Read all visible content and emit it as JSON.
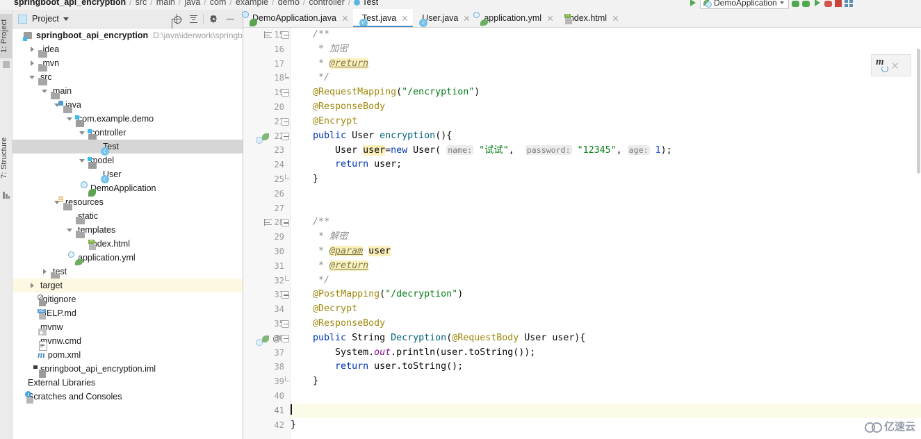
{
  "window": {
    "breadcrumb": [
      "springboot_api_encryption",
      "src",
      "main",
      "java",
      "com",
      "example",
      "demo",
      "controller",
      "Test"
    ],
    "run_config_label": "DemoApplication"
  },
  "left_tool_tabs": [
    {
      "label": "1: Project",
      "selected": true,
      "icon": "project-icon"
    },
    {
      "label": "7: Structure",
      "selected": false,
      "icon": "structure-icon"
    }
  ],
  "project_panel": {
    "title": "Project",
    "toolbar": [
      {
        "name": "locate-in-tree-icon",
        "tooltip": "Select Opened File"
      },
      {
        "name": "collapse-all-icon",
        "tooltip": "Collapse All"
      },
      {
        "name": "gear-icon",
        "tooltip": "Settings"
      },
      {
        "name": "minimize-icon",
        "tooltip": "Hide"
      }
    ],
    "root": {
      "label": "springboot_api_encryption",
      "path": "D:\\java\\iderwork\\springbo"
    },
    "items": [
      {
        "label": ".idea",
        "indent": 1,
        "icon": "folder-icon",
        "arrow": "right",
        "state": "normal"
      },
      {
        "label": ".mvn",
        "indent": 1,
        "icon": "folder-icon",
        "arrow": "right",
        "state": "normal"
      },
      {
        "label": "src",
        "indent": 1,
        "icon": "folder-icon",
        "arrow": "down",
        "state": "normal"
      },
      {
        "label": "main",
        "indent": 2,
        "icon": "folder-icon",
        "arrow": "down",
        "state": "normal"
      },
      {
        "label": "java",
        "indent": 3,
        "icon": "source-folder-icon",
        "arrow": "down",
        "state": "normal"
      },
      {
        "label": "com.example.demo",
        "indent": 4,
        "icon": "package-icon",
        "arrow": "down",
        "state": "normal"
      },
      {
        "label": "controller",
        "indent": 5,
        "icon": "package-icon",
        "arrow": "down",
        "state": "normal"
      },
      {
        "label": "Test",
        "indent": 6,
        "icon": "java-class-icon",
        "arrow": "none",
        "state": "selected"
      },
      {
        "label": "model",
        "indent": 5,
        "icon": "package-icon",
        "arrow": "down",
        "state": "normal"
      },
      {
        "label": "User",
        "indent": 6,
        "icon": "java-class-icon",
        "arrow": "none",
        "state": "normal"
      },
      {
        "label": "DemoApplication",
        "indent": 5,
        "icon": "spring-class-icon",
        "arrow": "none",
        "state": "normal"
      },
      {
        "label": "resources",
        "indent": 3,
        "icon": "resource-folder-icon",
        "arrow": "down",
        "state": "normal"
      },
      {
        "label": "static",
        "indent": 4,
        "icon": "folder-icon",
        "arrow": "none",
        "state": "normal"
      },
      {
        "label": "templates",
        "indent": 4,
        "icon": "folder-icon",
        "arrow": "down",
        "state": "normal"
      },
      {
        "label": "index.html",
        "indent": 5,
        "icon": "html-file-icon",
        "arrow": "none",
        "state": "normal"
      },
      {
        "label": "application.yml",
        "indent": 4,
        "icon": "yml-spring-icon",
        "arrow": "none",
        "state": "normal"
      },
      {
        "label": "test",
        "indent": 2,
        "icon": "folder-icon",
        "arrow": "right",
        "state": "normal"
      },
      {
        "label": "target",
        "indent": 1,
        "icon": "folder-orange-icon",
        "arrow": "right",
        "state": "highlight"
      },
      {
        "label": ".gitignore",
        "indent": 1,
        "icon": "gitignore-icon",
        "arrow": "none",
        "state": "normal"
      },
      {
        "label": "HELP.md",
        "indent": 1,
        "icon": "markdown-icon",
        "arrow": "none",
        "state": "normal"
      },
      {
        "label": "mvnw",
        "indent": 1,
        "icon": "shell-script-icon",
        "arrow": "none",
        "state": "normal"
      },
      {
        "label": "mvnw.cmd",
        "indent": 1,
        "icon": "text-file-icon",
        "arrow": "none",
        "state": "normal"
      },
      {
        "label": "pom.xml",
        "indent": 1,
        "icon": "maven-xml-icon",
        "arrow": "none",
        "state": "normal"
      },
      {
        "label": "springboot_api_encryption.iml",
        "indent": 1,
        "icon": "iml-module-icon",
        "arrow": "none",
        "state": "normal"
      },
      {
        "label": "External Libraries",
        "indent": 0,
        "icon": "external-libraries-icon",
        "arrow": "none",
        "state": "normal"
      },
      {
        "label": "Scratches and Consoles",
        "indent": 0,
        "icon": "scratches-icon",
        "arrow": "none",
        "state": "normal"
      }
    ]
  },
  "editor_tabs": [
    {
      "label": "DemoApplication.java",
      "icon": "spring-class-icon",
      "active": false
    },
    {
      "label": "Test.java",
      "icon": "java-class-icon",
      "active": true
    },
    {
      "label": "User.java",
      "icon": "java-class-icon",
      "active": false
    },
    {
      "label": "application.yml",
      "icon": "yml-spring-icon",
      "active": false
    },
    {
      "label": "index.html",
      "icon": "html-file-icon",
      "active": false
    }
  ],
  "code": {
    "first_line": 15,
    "lines": [
      {
        "n": 15,
        "fold": "open",
        "bookmark": true,
        "tokens": [
          {
            "t": "    ",
            "c": "pln"
          },
          {
            "t": "/**",
            "c": "cmt"
          }
        ]
      },
      {
        "n": 16,
        "tokens": [
          {
            "t": "     * ",
            "c": "cmt"
          },
          {
            "t": "加密",
            "c": "cmt"
          }
        ]
      },
      {
        "n": 17,
        "tokens": [
          {
            "t": "     * ",
            "c": "cmt"
          },
          {
            "t": "@return",
            "c": "tag hlv"
          }
        ]
      },
      {
        "n": 18,
        "fold": "tail",
        "tokens": [
          {
            "t": "     */",
            "c": "cmt"
          }
        ]
      },
      {
        "n": 19,
        "fold": "open",
        "tokens": [
          {
            "t": "    ",
            "c": "pln"
          },
          {
            "t": "@RequestMapping",
            "c": "anno"
          },
          {
            "t": "(",
            "c": "pln"
          },
          {
            "t": "\"/encryption\"",
            "c": "str"
          },
          {
            "t": ")",
            "c": "pln"
          }
        ]
      },
      {
        "n": 20,
        "tokens": [
          {
            "t": "    ",
            "c": "pln"
          },
          {
            "t": "@ResponseBody",
            "c": "anno"
          }
        ]
      },
      {
        "n": 21,
        "fold": "open",
        "tokens": [
          {
            "t": "    ",
            "c": "pln"
          },
          {
            "t": "@Encrypt",
            "c": "anno"
          }
        ]
      },
      {
        "n": 22,
        "fold": "open",
        "spring": true,
        "tokens": [
          {
            "t": "    ",
            "c": "pln"
          },
          {
            "t": "public",
            "c": "kw"
          },
          {
            "t": " User ",
            "c": "pln"
          },
          {
            "t": "encryption",
            "c": "meth"
          },
          {
            "t": "(){",
            "c": "pln"
          }
        ]
      },
      {
        "n": 23,
        "tokens": [
          {
            "t": "        User ",
            "c": "pln"
          },
          {
            "t": "user",
            "c": "pln hlv"
          },
          {
            "t": "=",
            "c": "pln"
          },
          {
            "t": "new",
            "c": "kw"
          },
          {
            "t": " User( ",
            "c": "pln"
          },
          {
            "t": "name:",
            "c": "hint"
          },
          {
            "t": " ",
            "c": "pln"
          },
          {
            "t": "\"试试\"",
            "c": "str"
          },
          {
            "t": ",  ",
            "c": "pln"
          },
          {
            "t": "password:",
            "c": "hint"
          },
          {
            "t": " ",
            "c": "pln"
          },
          {
            "t": "\"12345\"",
            "c": "str"
          },
          {
            "t": ", ",
            "c": "pln"
          },
          {
            "t": "age:",
            "c": "hint"
          },
          {
            "t": " ",
            "c": "pln"
          },
          {
            "t": "1",
            "c": "num"
          },
          {
            "t": ");",
            "c": "pln"
          }
        ]
      },
      {
        "n": 24,
        "tokens": [
          {
            "t": "        ",
            "c": "pln"
          },
          {
            "t": "return",
            "c": "kw"
          },
          {
            "t": " user;",
            "c": "pln"
          }
        ]
      },
      {
        "n": 25,
        "fold": "tail",
        "tokens": [
          {
            "t": "    }",
            "c": "pln"
          }
        ]
      },
      {
        "n": 26,
        "tokens": []
      },
      {
        "n": 27,
        "tokens": []
      },
      {
        "n": 28,
        "fold": "open",
        "bookmark": true,
        "tokens": [
          {
            "t": "    ",
            "c": "pln"
          },
          {
            "t": "/**",
            "c": "cmt"
          }
        ]
      },
      {
        "n": 29,
        "tokens": [
          {
            "t": "     * ",
            "c": "cmt"
          },
          {
            "t": "解密",
            "c": "cmt"
          }
        ]
      },
      {
        "n": 30,
        "tokens": [
          {
            "t": "     * ",
            "c": "cmt"
          },
          {
            "t": "@param",
            "c": "tag hlv"
          },
          {
            "t": " ",
            "c": "pln"
          },
          {
            "t": "user",
            "c": "pln hlv"
          }
        ]
      },
      {
        "n": 31,
        "tokens": [
          {
            "t": "     * ",
            "c": "cmt"
          },
          {
            "t": "@return",
            "c": "tag hlv"
          }
        ]
      },
      {
        "n": 32,
        "fold": "tail",
        "tokens": [
          {
            "t": "     */",
            "c": "cmt"
          }
        ]
      },
      {
        "n": 33,
        "fold": "open",
        "tokens": [
          {
            "t": "    ",
            "c": "pln"
          },
          {
            "t": "@PostMapping",
            "c": "anno"
          },
          {
            "t": "(",
            "c": "pln"
          },
          {
            "t": "\"/decryption\"",
            "c": "str"
          },
          {
            "t": ")",
            "c": "pln"
          }
        ]
      },
      {
        "n": 34,
        "tokens": [
          {
            "t": "    ",
            "c": "pln"
          },
          {
            "t": "@Decrypt",
            "c": "anno"
          }
        ]
      },
      {
        "n": 35,
        "fold": "open",
        "tokens": [
          {
            "t": "    ",
            "c": "pln"
          },
          {
            "t": "@ResponseBody",
            "c": "anno"
          }
        ]
      },
      {
        "n": 36,
        "fold": "open",
        "spring": true,
        "at": true,
        "tokens": [
          {
            "t": "    ",
            "c": "pln"
          },
          {
            "t": "public",
            "c": "kw"
          },
          {
            "t": " String ",
            "c": "pln"
          },
          {
            "t": "Decryption",
            "c": "meth"
          },
          {
            "t": "(",
            "c": "pln"
          },
          {
            "t": "@RequestBody",
            "c": "anno"
          },
          {
            "t": " User user){",
            "c": "pln"
          }
        ]
      },
      {
        "n": 37,
        "tokens": [
          {
            "t": "        System.",
            "c": "pln"
          },
          {
            "t": "out",
            "c": "fld"
          },
          {
            "t": ".println(user.toString());",
            "c": "pln"
          }
        ]
      },
      {
        "n": 38,
        "tokens": [
          {
            "t": "        ",
            "c": "pln"
          },
          {
            "t": "return",
            "c": "kw"
          },
          {
            "t": " user.toString();",
            "c": "pln"
          }
        ]
      },
      {
        "n": 39,
        "fold": "tail",
        "tokens": [
          {
            "t": "    }",
            "c": "pln"
          }
        ]
      },
      {
        "n": 40,
        "tokens": []
      },
      {
        "n": 41,
        "caret": true,
        "tokens": []
      },
      {
        "n": 42,
        "tokens": [
          {
            "t": "}",
            "c": "pln"
          }
        ]
      }
    ]
  },
  "notification": {
    "icon": "maven-reload-icon",
    "close_icon": "close-icon"
  },
  "watermark": {
    "text": "亿速云"
  },
  "colors": {
    "accent": "#4a90c4",
    "keyword": "#0033b3",
    "string": "#067d17",
    "annotation": "#9e880d",
    "comment": "#8c8c8c",
    "method": "#00627a",
    "field": "#871094",
    "number": "#1750eb",
    "caret_line": "#fcfbe9",
    "selection": "#d6d6d6",
    "highlight_row": "#fdf8e2"
  }
}
